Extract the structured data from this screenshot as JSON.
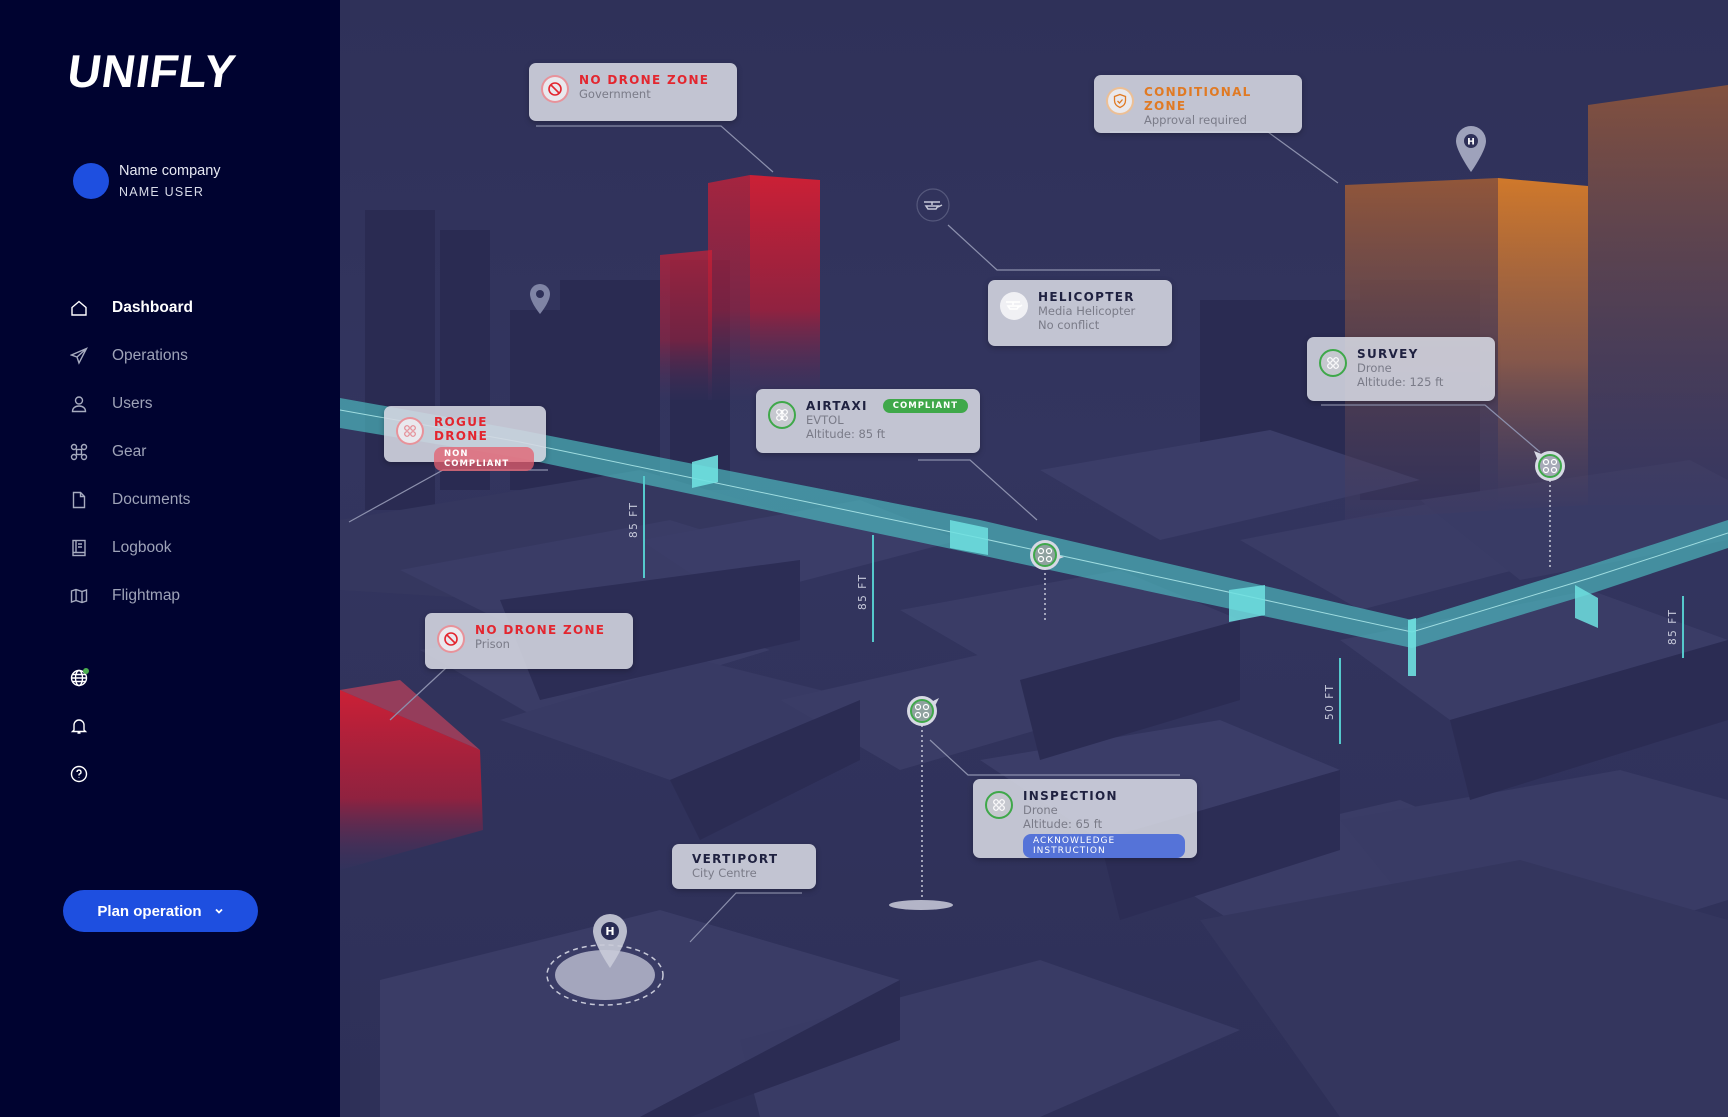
{
  "app": {
    "logo": "UNIFLY"
  },
  "user": {
    "company": "Name company",
    "name": "NAME USER",
    "avatar_color": "#1e4fe0"
  },
  "sidebar": {
    "items": [
      {
        "label": "Dashboard",
        "icon": "home-icon",
        "active": true
      },
      {
        "label": "Operations",
        "icon": "paper-plane-icon",
        "active": false
      },
      {
        "label": "Users",
        "icon": "user-icon",
        "active": false
      },
      {
        "label": "Gear",
        "icon": "drone-icon",
        "active": false
      },
      {
        "label": "Documents",
        "icon": "document-icon",
        "active": false
      },
      {
        "label": "Logbook",
        "icon": "logbook-icon",
        "active": false
      },
      {
        "label": "Flightmap",
        "icon": "map-icon",
        "active": false
      }
    ],
    "utilities": [
      {
        "icon": "globe-icon",
        "status_dot": "#4caf50"
      },
      {
        "icon": "bell-icon"
      },
      {
        "icon": "help-icon"
      }
    ],
    "plan_button": {
      "label": "Plan operation",
      "icon": "chevron-down-icon"
    }
  },
  "colors": {
    "accent": "#1e4fe0",
    "no_drone_zone": "#e3262f",
    "conditional_zone": "#e07a24",
    "compliant": "#3fa84a",
    "flight_corridor": "#4fc6c8",
    "acknowledge": "#5573d8"
  },
  "map": {
    "cards": [
      {
        "id": "no-drone-zone-government",
        "title": "NO DRONE ZONE",
        "subtitle": "Government",
        "icon": "prohibited-icon",
        "type": "red"
      },
      {
        "id": "conditional-zone",
        "title": "CONDITIONAL ZONE",
        "subtitle": "Approval required",
        "icon": "shield-check-icon",
        "type": "orange"
      },
      {
        "id": "helicopter",
        "title": "HELICOPTER",
        "subtitle": "Media Helicopter",
        "subtitle2": "No conflict",
        "icon": "helicopter-icon",
        "type": "plain"
      },
      {
        "id": "survey",
        "title": "SURVEY",
        "subtitle": "Drone",
        "subtitle2": "Altitude: 125 ft",
        "icon": "drone-icon",
        "type": "green"
      },
      {
        "id": "airtaxi",
        "title": "AIRTAXI",
        "subtitle": "EVTOL",
        "subtitle2": "Altitude: 85 ft",
        "badge": "COMPLIANT",
        "icon": "evtol-icon",
        "type": "green"
      },
      {
        "id": "rogue-drone",
        "title": "ROGUE DRONE",
        "badge": "NON COMPLIANT",
        "icon": "drone-icon",
        "type": "red"
      },
      {
        "id": "no-drone-zone-prison",
        "title": "NO DRONE ZONE",
        "subtitle": "Prison",
        "icon": "prohibited-icon",
        "type": "red"
      },
      {
        "id": "inspection",
        "title": "INSPECTION",
        "subtitle": "Drone",
        "subtitle2": "Altitude: 65 ft",
        "badge": "ACKNOWLEDGE INSTRUCTION",
        "icon": "drone-icon",
        "type": "green"
      },
      {
        "id": "vertiport",
        "title": "VERTIPORT",
        "subtitle": "City Centre",
        "type": "none"
      }
    ],
    "altitude_markers": [
      "85 FT",
      "85 FT",
      "50 FT",
      "85 FT"
    ],
    "pins": [
      {
        "label": "H",
        "icon": "helipad-pin-icon"
      },
      {
        "label": "H",
        "icon": "vertiport-pin-icon"
      },
      {
        "icon": "location-pin-icon"
      }
    ]
  }
}
